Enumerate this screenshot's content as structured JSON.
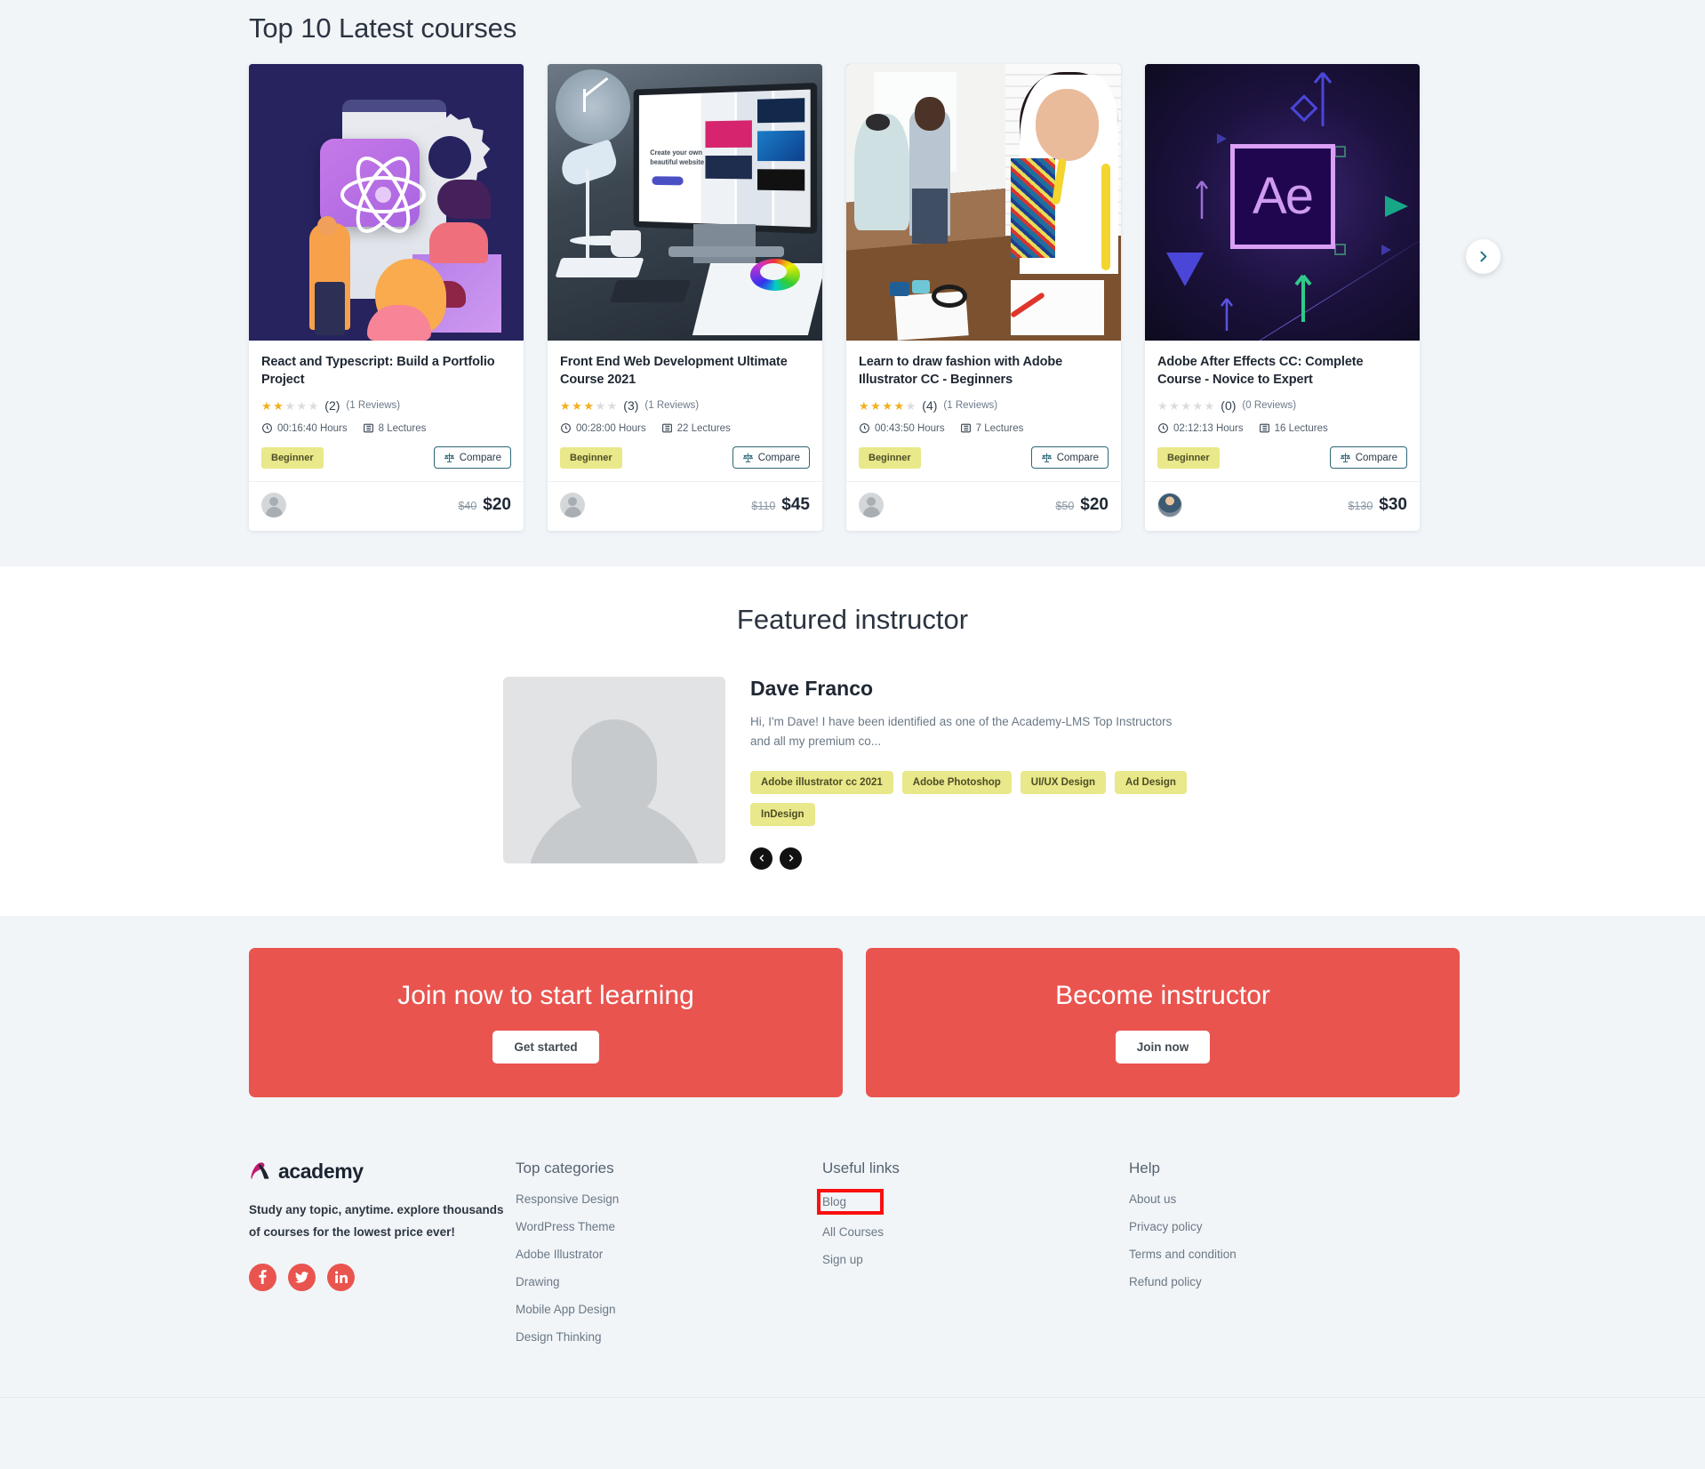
{
  "courses_section": {
    "title": "Top 10 Latest courses",
    "next_arrow_icon": "chevron-right-icon",
    "cards": [
      {
        "title": "React and Typescript: Build a Portfolio Project",
        "thumb": "react-illustration",
        "stars_filled": 2,
        "rating_value": "(2)",
        "reviews": "(1 Reviews)",
        "duration": "00:16:40 Hours",
        "lectures": "8 Lectures",
        "level": "Beginner",
        "compare": "Compare",
        "price_old": "$40",
        "price_new": "$20",
        "avatar": "placeholder"
      },
      {
        "title": "Front End Web Development Ultimate Course 2021",
        "thumb": "desk-photo",
        "stars_filled": 3,
        "rating_value": "(3)",
        "reviews": "(1 Reviews)",
        "duration": "00:28:00 Hours",
        "lectures": "22 Lectures",
        "level": "Beginner",
        "compare": "Compare",
        "price_old": "$110",
        "price_new": "$45",
        "avatar": "placeholder"
      },
      {
        "title": "Learn to draw fashion with Adobe Illustrator CC - Beginners",
        "thumb": "fashion-photo",
        "stars_filled": 4,
        "rating_value": "(4)",
        "reviews": "(1 Reviews)",
        "duration": "00:43:50 Hours",
        "lectures": "7 Lectures",
        "level": "Beginner",
        "compare": "Compare",
        "price_old": "$50",
        "price_new": "$20",
        "avatar": "placeholder"
      },
      {
        "title": "Adobe After Effects CC: Complete Course - Novice to Expert",
        "thumb": "after-effects-logo",
        "stars_filled": 0,
        "rating_value": "(0)",
        "reviews": "(0 Reviews)",
        "duration": "02:12:13 Hours",
        "lectures": "16 Lectures",
        "level": "Beginner",
        "compare": "Compare",
        "price_old": "$130",
        "price_new": "$30",
        "avatar": "photo"
      }
    ]
  },
  "instructor_section": {
    "title": "Featured instructor",
    "name": "Dave Franco",
    "bio": "Hi, I'm Dave! I have been identified as one of the Academy-LMS Top Instructors and all my premium co...",
    "skills": [
      "Adobe illustrator cc 2021",
      "Adobe Photoshop",
      "UI/UX Design",
      "Ad Design",
      "InDesign"
    ],
    "prev_icon": "chevron-left-icon",
    "next_icon": "chevron-right-icon"
  },
  "cta_section": {
    "cards": [
      {
        "title": "Join now to start learning",
        "button": "Get started"
      },
      {
        "title": "Become instructor",
        "button": "Join now"
      }
    ]
  },
  "footer": {
    "brand_name": "academy",
    "brand_logo_icon": "academy-a-logo",
    "brand_desc": "Study any topic, anytime. explore thousands of courses for the lowest price ever!",
    "socials": [
      {
        "icon": "facebook-icon",
        "glyph": "f"
      },
      {
        "icon": "twitter-icon",
        "glyph": "ᵛ"
      },
      {
        "icon": "linkedin-icon",
        "glyph": "in"
      }
    ],
    "categories_title": "Top categories",
    "categories": [
      "Responsive Design",
      "WordPress Theme",
      "Adobe Illustrator",
      "Drawing",
      "Mobile App Design",
      "Design Thinking"
    ],
    "useful_title": "Useful links",
    "useful_links": [
      "Blog",
      "All Courses",
      "Sign up"
    ],
    "help_title": "Help",
    "help_links": [
      "About us",
      "Privacy policy",
      "Terms and condition",
      "Refund policy"
    ]
  },
  "colors": {
    "accent_red": "#e9544f",
    "badge_yellow": "#e9e88a",
    "page_bg": "#f1f5f8",
    "highlight_outline": "#fb0f0f",
    "star_gold": "#f2b01e"
  }
}
